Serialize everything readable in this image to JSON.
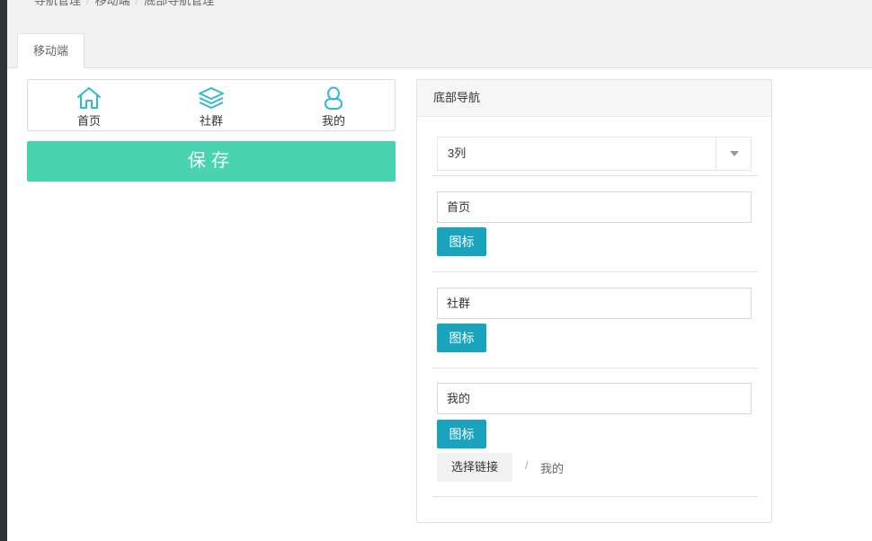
{
  "breadcrumb": [
    "导航管理",
    "移动端",
    "底部导航管理"
  ],
  "tab": {
    "label": "移动端"
  },
  "preview": {
    "items": [
      {
        "label": "首页",
        "icon": "home-icon"
      },
      {
        "label": "社群",
        "icon": "layers-icon"
      },
      {
        "label": "我的",
        "icon": "user-icon"
      }
    ],
    "save_label": "保存",
    "accent": "#48d3b1",
    "icon_color": "#2fb9d6"
  },
  "panel": {
    "title": "底部导航",
    "columns_select": {
      "value": "3列"
    },
    "items": [
      {
        "name": "首页",
        "icon_button": "图标"
      },
      {
        "name": "社群",
        "icon_button": "图标"
      },
      {
        "name": "我的",
        "icon_button": "图标",
        "link_button": "选择链接",
        "link_separator": "/",
        "link_value": "我的"
      }
    ],
    "button_color": "#1aa3bd"
  }
}
